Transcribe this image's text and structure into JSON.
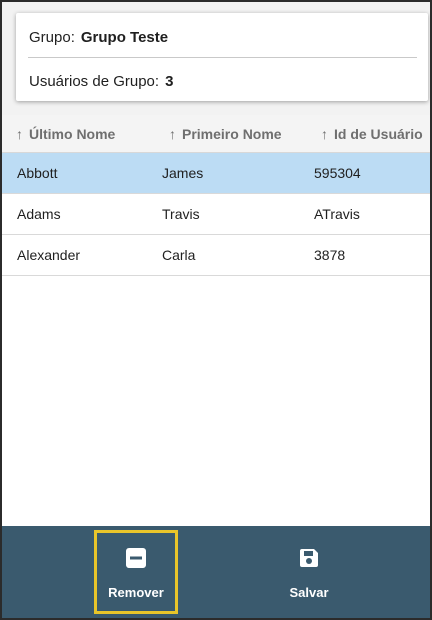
{
  "group_info": {
    "group_label": "Grupo:",
    "group_name": "Grupo Teste",
    "users_label": "Usuários de Grupo:",
    "users_count": "3"
  },
  "table": {
    "sort_arrow": "↑",
    "columns": [
      "Último Nome",
      "Primeiro Nome",
      "Id de Usuário"
    ],
    "rows": [
      {
        "last_name": "Abbott",
        "first_name": "James",
        "user_id": "595304",
        "selected": true
      },
      {
        "last_name": "Adams",
        "first_name": "Travis",
        "user_id": "ATravis",
        "selected": false
      },
      {
        "last_name": "Alexander",
        "first_name": "Carla",
        "user_id": "3878",
        "selected": false
      }
    ]
  },
  "toolbar": {
    "remove_label": "Remover",
    "remove_icon": "minus-square-icon",
    "save_label": "Salvar",
    "save_icon": "floppy-disk-icon"
  },
  "colors": {
    "toolbar_bg": "#3a5a6e",
    "selected_row": "#bcdcf4",
    "highlight_border": "#e9c52a"
  }
}
